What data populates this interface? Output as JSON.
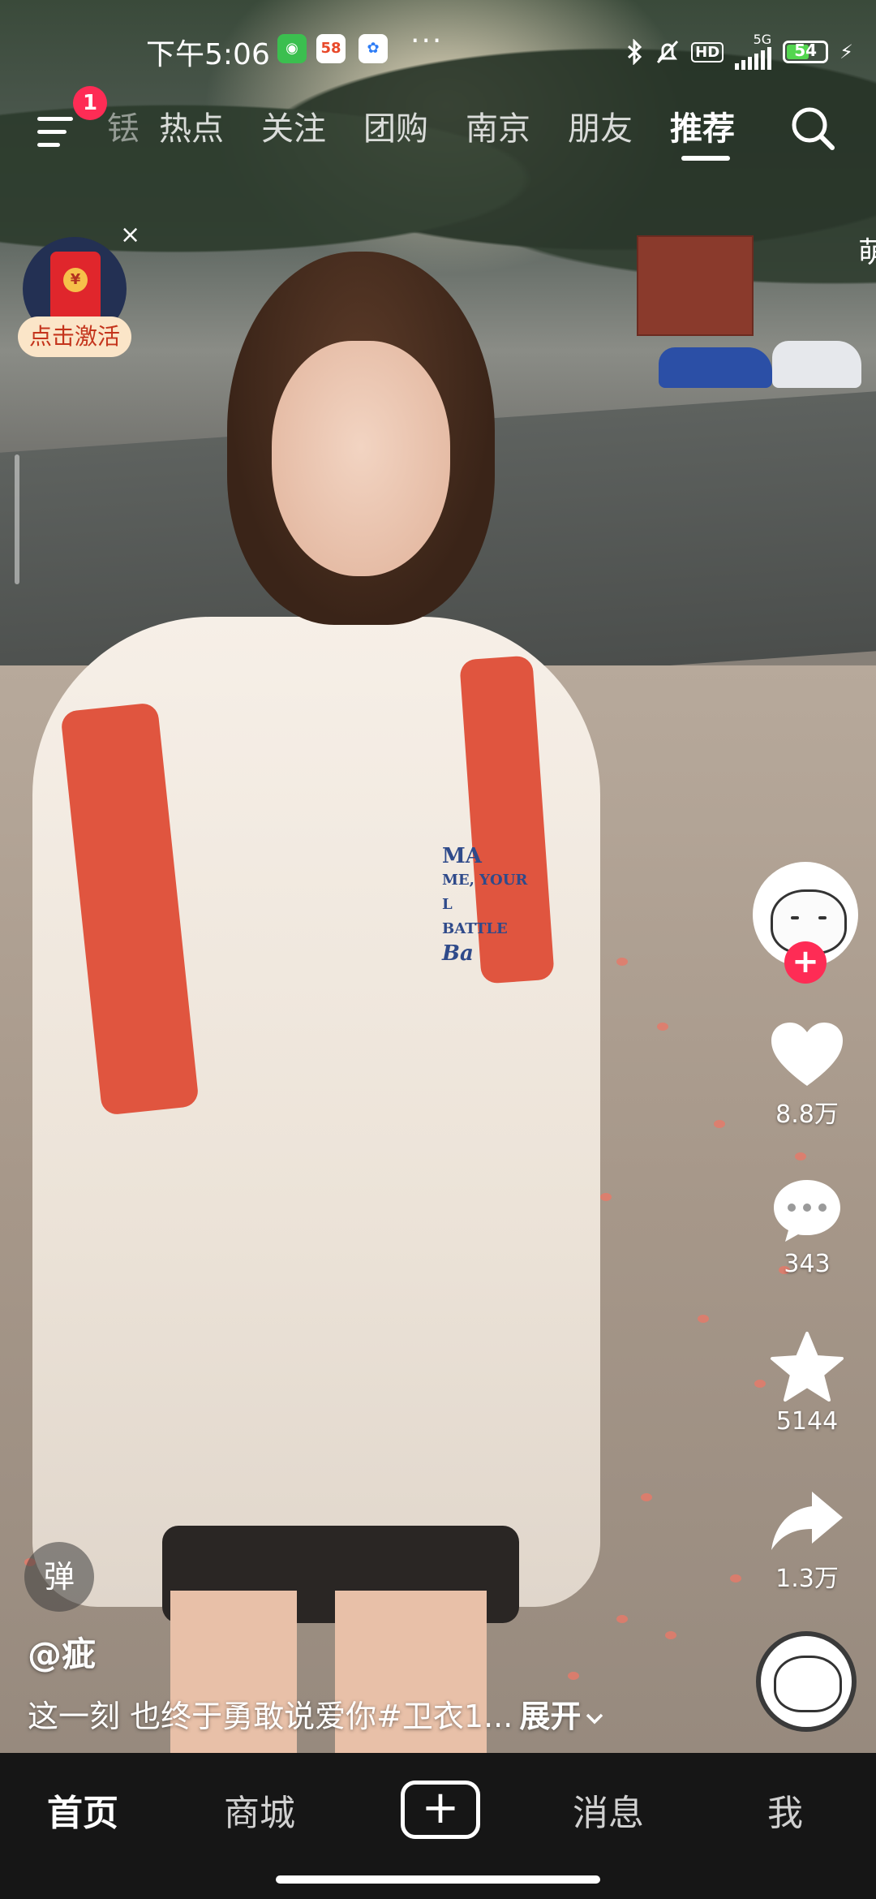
{
  "status_bar": {
    "time": "下午5:06",
    "app_icons": [
      "wechat-mini-icon",
      "58-icon",
      "cloud-icon"
    ],
    "more": "···",
    "network": "5G",
    "battery_level": "54",
    "hd_label": "HD"
  },
  "top_nav": {
    "badge_count": "1",
    "partial_tab": "铥",
    "tabs": [
      "热点",
      "关注",
      "团购",
      "南京",
      "朋友",
      "推荐"
    ],
    "active_tab": "推荐"
  },
  "red_packet": {
    "close": "×",
    "coin": "¥",
    "label": "点击激活"
  },
  "edge_text": "萌",
  "actions": {
    "follow_plus": "+",
    "like_count": "8.8万",
    "comment_count": "343",
    "favorite_count": "5144",
    "share_count": "1.3万"
  },
  "video": {
    "shirt_print": [
      "MA",
      "ME, YOUR L",
      "BATTLE",
      "Ba"
    ],
    "danmu_button": "弹",
    "author": "@疵",
    "caption": "这一刻 也终于勇敢说爱你#卫衣1...",
    "expand": "展开"
  },
  "bottom_nav": {
    "home": "首页",
    "mall": "商城",
    "create": "+",
    "messages": "消息",
    "me": "我"
  },
  "colors": {
    "accent": "#fe2c55",
    "battery": "#53d64f",
    "tabbar_bg": "#161616"
  }
}
